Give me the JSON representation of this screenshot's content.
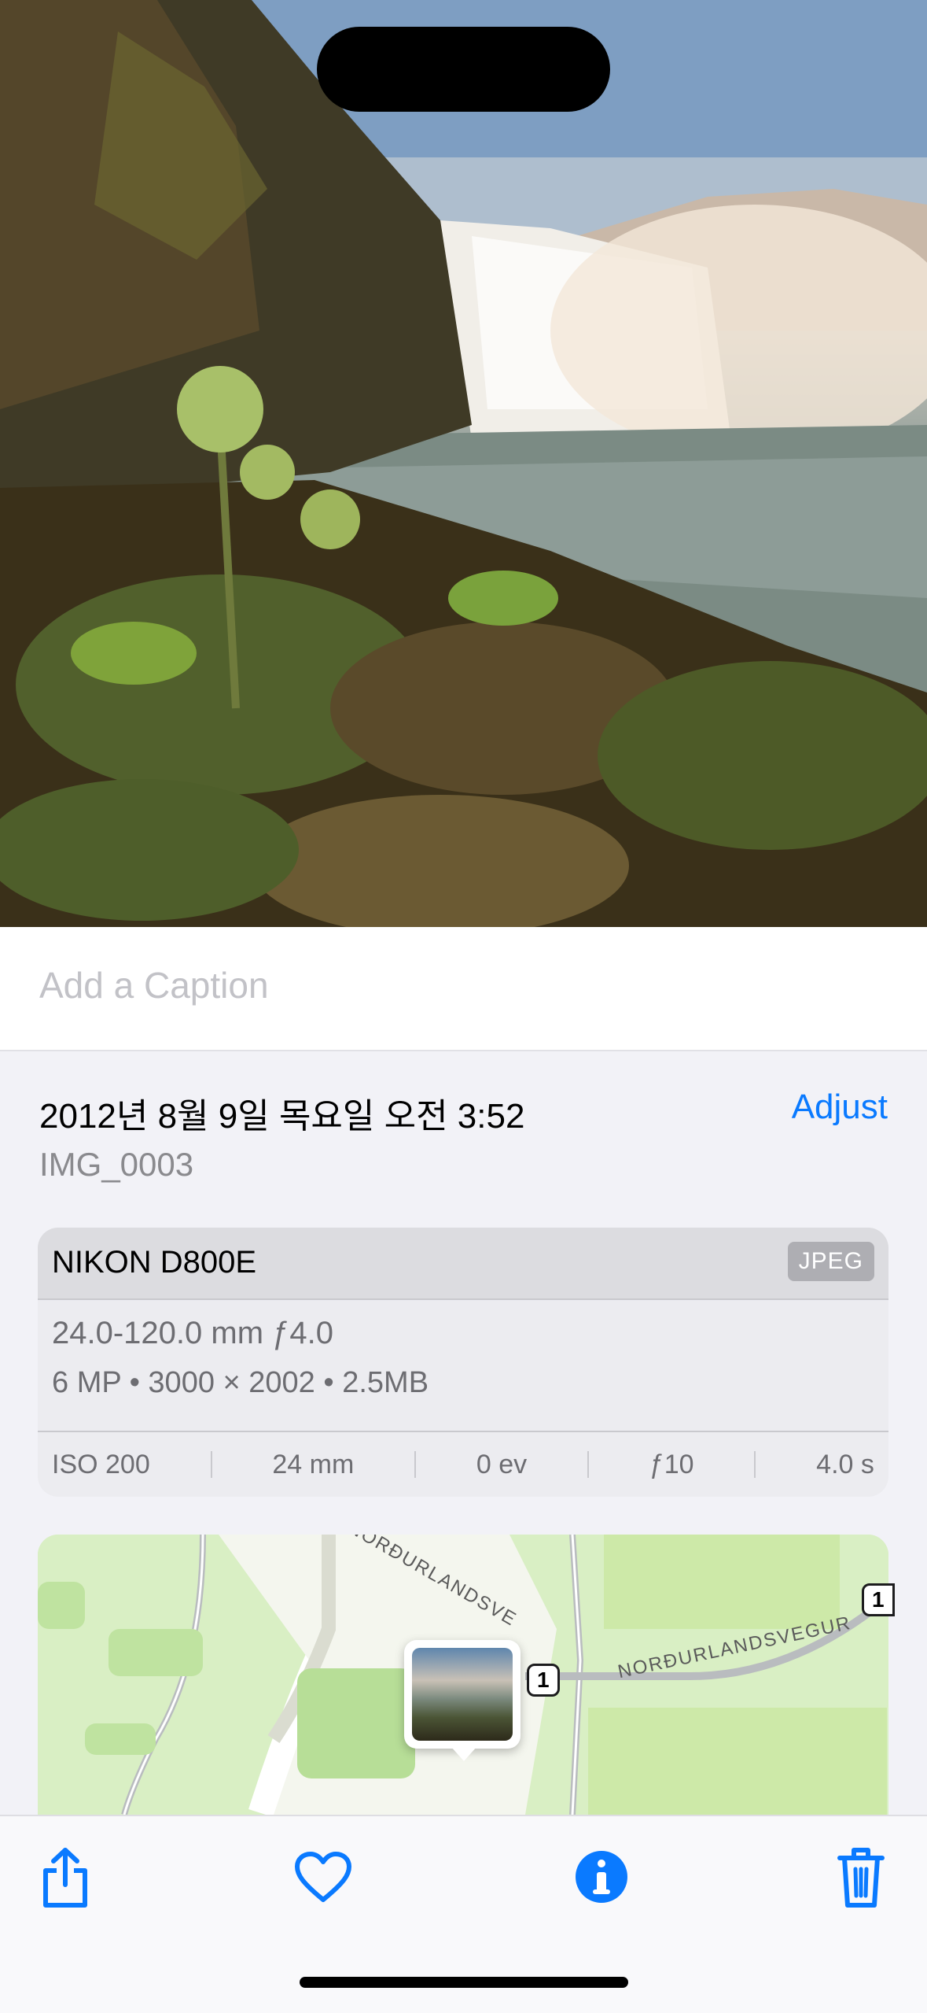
{
  "photo": {
    "description_icon": "photo"
  },
  "caption": {
    "placeholder": "Add a Caption"
  },
  "meta": {
    "date": "2012년 8월 9일 목요일 오전 3:52",
    "adjust_label": "Adjust",
    "filename": "IMG_0003"
  },
  "camera": {
    "model": "NIKON D800E",
    "format": "JPEG",
    "lens": "24.0-120.0 mm ƒ4.0",
    "details": "6 MP  •  3000 × 2002  •  2.5MB",
    "exif": [
      "ISO 200",
      "24 mm",
      "0 ev",
      "ƒ10",
      "4.0 s"
    ]
  },
  "map": {
    "road_name_1": "NORÐURLANDSVE",
    "road_name_2": "NORÐURLANDSVEGUR",
    "route_number": "1"
  },
  "toolbar": {
    "share_icon": "share-icon",
    "favorite_icon": "heart-icon",
    "info_icon": "info-icon",
    "delete_icon": "trash-icon"
  },
  "colors": {
    "accent": "#0a7aff"
  }
}
